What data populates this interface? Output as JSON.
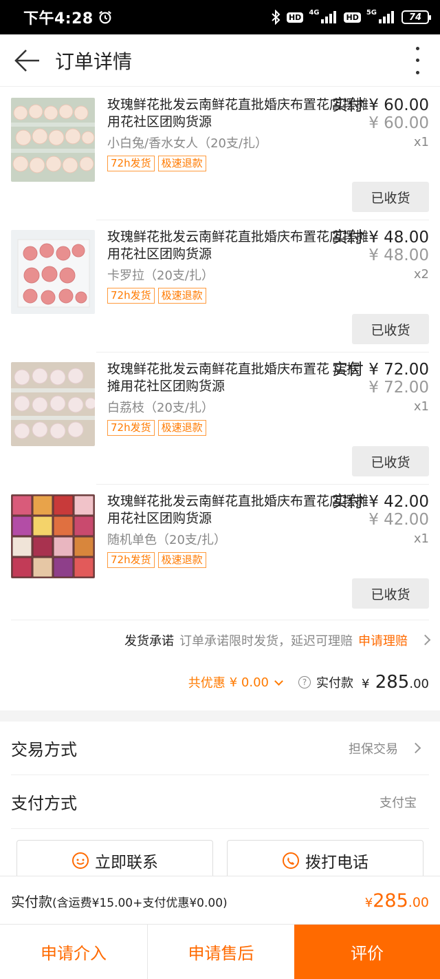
{
  "status_bar": {
    "time": "下午4:28",
    "hd1": "HD",
    "net1": "4G",
    "hd2": "HD",
    "net2": "5G",
    "battery": "74"
  },
  "header": {
    "title": "订单详情"
  },
  "items": [
    {
      "name": "玫瑰鲜花批发云南鲜花直批婚庆布置花店摆摊用花社区团购货源",
      "price_label": "实付",
      "price": "¥ 60.00",
      "original_price": "¥ 60.00",
      "spec": "小白兔/香水女人（20支/扎）",
      "qty": "x1",
      "tags": [
        "72h发货",
        "极速退款"
      ],
      "button": "已收货"
    },
    {
      "name": "玫瑰鲜花批发云南鲜花直批婚庆布置花店摆摊用花社区团购货源",
      "price_label": "实付",
      "price": "¥ 48.00",
      "original_price": "¥ 48.00",
      "spec": "卡罗拉（20支/扎）",
      "qty": "x2",
      "tags": [
        "72h发货",
        "极速退款"
      ],
      "button": "已收货"
    },
    {
      "name": "玫瑰鲜花批发云南鲜花直批婚庆布置花 店摆摊用花社区团购货源",
      "price_label": "实付",
      "price": "¥ 72.00",
      "original_price": "¥ 72.00",
      "spec": "白荔枝（20支/扎）",
      "qty": "x1",
      "tags": [
        "72h发货",
        "极速退款"
      ],
      "button": "已收货"
    },
    {
      "name": "玫瑰鲜花批发云南鲜花直批婚庆布置花店摆摊用花社区团购货源",
      "price_label": "实付",
      "price": "¥ 42.00",
      "original_price": "¥ 42.00",
      "spec": "随机单色（20支/扎）",
      "qty": "x1",
      "tags": [
        "72h发货",
        "极速退款"
      ],
      "button": "已收货"
    }
  ],
  "promise": {
    "label": "发货承诺",
    "text": "订单承诺限时发货，延迟可理赔",
    "link": "申请理赔"
  },
  "summary": {
    "discount_label": "共优惠",
    "discount_value": "¥ 0.00",
    "paid_label": "实付款",
    "paid_currency": "¥",
    "paid_int": "285",
    "paid_dec": ".00"
  },
  "rows": [
    {
      "label": "交易方式",
      "value": "担保交易"
    },
    {
      "label": "支付方式",
      "value": "支付宝"
    }
  ],
  "actions": {
    "contact": "立即联系",
    "call": "拨打电话"
  },
  "total": {
    "label": "实付款",
    "detail": "(含运费¥15.00+支付优惠¥0.00)",
    "currency": "¥",
    "int": "285",
    "dec": ".00"
  },
  "bottom": {
    "intervene": "申请介入",
    "after_sale": "申请售后",
    "review": "评价"
  },
  "colors": {
    "accent": "#ff6a00",
    "tag": "#ff7a00"
  }
}
